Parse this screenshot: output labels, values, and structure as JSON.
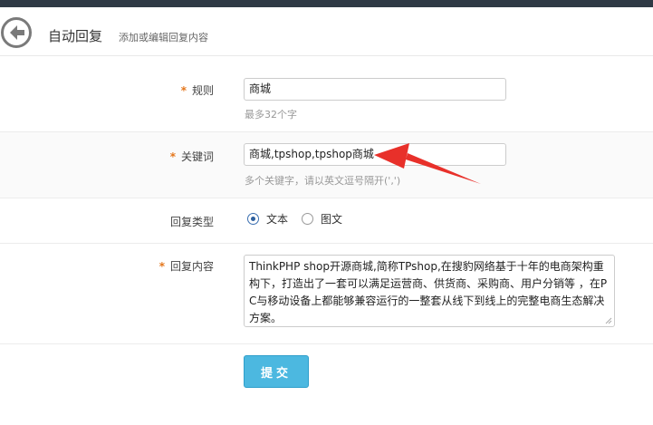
{
  "header": {
    "title": "自动回复",
    "subtitle": "添加或编辑回复内容"
  },
  "form": {
    "rule": {
      "label": "规则",
      "value": "商城",
      "hint": "最多32个字"
    },
    "keyword": {
      "label": "关键词",
      "value": "商城,tpshop,tpshop商城",
      "hint": "多个关键字，请以英文逗号隔开(',')"
    },
    "reply_type": {
      "label": "回复类型",
      "options": [
        "文本",
        "图文"
      ],
      "selected": "文本"
    },
    "reply_content": {
      "label": "回复内容",
      "value": "ThinkPHP shop开源商城,简称TPshop,在搜豹网络基于十年的电商架构重构下，打造出了一套可以满足运营商、供货商、采购商、用户分销等 ，在PC与移动设备上都能够兼容运行的一整套从线下到线上的完整电商生态解决方案。"
    },
    "submit_label": "提交"
  },
  "colors": {
    "accent": "#4cb8e0",
    "required_star": "#e4761b",
    "annotation_arrow": "#e8302a"
  },
  "icons": {
    "back": "back-arrow-icon"
  }
}
